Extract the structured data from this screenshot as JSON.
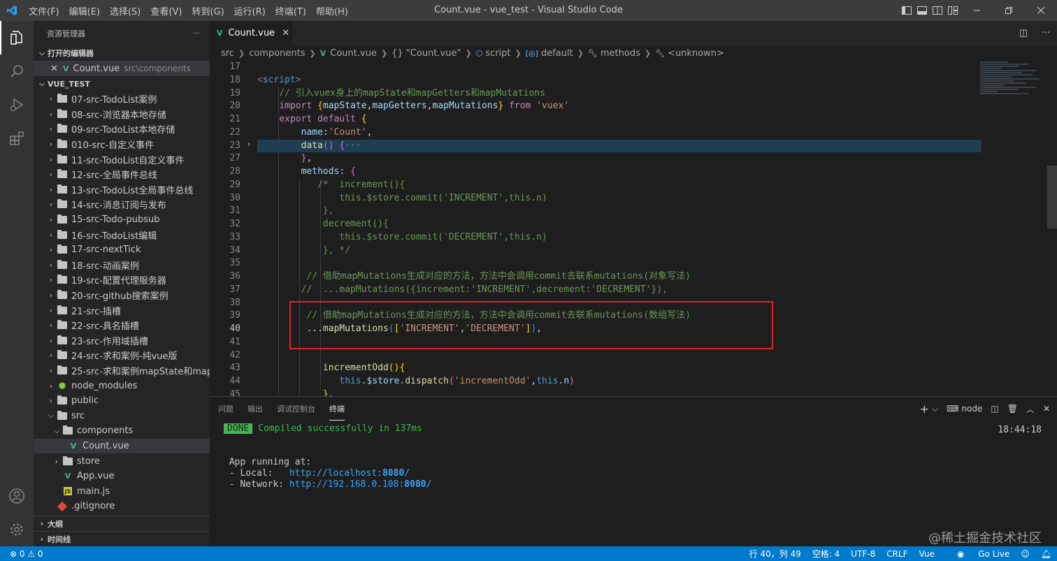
{
  "window": {
    "title": "Count.vue - vue_test - Visual Studio Code",
    "menu": [
      "文件(F)",
      "编辑(E)",
      "选择(S)",
      "查看(V)",
      "转到(G)",
      "运行(R)",
      "终端(T)",
      "帮助(H)"
    ]
  },
  "sidebar": {
    "header": "资源管理器",
    "more": "···",
    "open_editors_label": "打开的编辑器",
    "open_file": {
      "name": "Count.vue",
      "path": "src\\components"
    },
    "project_label": "VUE_TEST",
    "tree": [
      {
        "label": "07-src-TodoList案例",
        "type": "folder"
      },
      {
        "label": "08-src-浏览器本地存储",
        "type": "folder"
      },
      {
        "label": "09-src-TodoList本地存储",
        "type": "folder"
      },
      {
        "label": "010-src-自定义事件",
        "type": "folder"
      },
      {
        "label": "11-src-TodoList自定义事件",
        "type": "folder"
      },
      {
        "label": "12-src-全局事件总线",
        "type": "folder"
      },
      {
        "label": "13-src-TodoList全局事件总线",
        "type": "folder"
      },
      {
        "label": "14-src-消息订阅与发布",
        "type": "folder"
      },
      {
        "label": "15-src-Todo-pubsub",
        "type": "folder"
      },
      {
        "label": "16-src-TodoList编辑",
        "type": "folder"
      },
      {
        "label": "17-src-nextTick",
        "type": "folder"
      },
      {
        "label": "18-src-动画案例",
        "type": "folder"
      },
      {
        "label": "19-src-配置代理服务器",
        "type": "folder"
      },
      {
        "label": "20-src-github搜索案例",
        "type": "folder"
      },
      {
        "label": "21-src-插槽",
        "type": "folder"
      },
      {
        "label": "22-src-具名插槽",
        "type": "folder"
      },
      {
        "label": "23-src-作用域插槽",
        "type": "folder"
      },
      {
        "label": "24-src-求和案例-纯vue版",
        "type": "folder"
      },
      {
        "label": "25-src-求和案例mapState和map...",
        "type": "folder"
      },
      {
        "label": "node_modules",
        "type": "node"
      },
      {
        "label": "public",
        "type": "folder"
      },
      {
        "label": "src",
        "type": "folder-open"
      },
      {
        "label": "components",
        "type": "folder-open",
        "depth": 1
      },
      {
        "label": "Count.vue",
        "type": "vue",
        "depth": 2
      },
      {
        "label": "store",
        "type": "folder",
        "depth": 1
      },
      {
        "label": "App.vue",
        "type": "vue",
        "depth": 1
      },
      {
        "label": "main.js",
        "type": "js",
        "depth": 1
      },
      {
        "label": ".gitignore",
        "type": "git",
        "depth": 0
      }
    ],
    "outline_label": "大纲",
    "timeline_label": "时间线"
  },
  "tab": {
    "label": "Count.vue",
    "close": "✕"
  },
  "breadcrumb": [
    "src",
    "components",
    "Count.vue",
    "{} \"Count.vue\"",
    "script",
    "default",
    "methods",
    "<unknown>"
  ],
  "editor": {
    "line_numbers": [
      "17",
      "18",
      "19",
      "20",
      "21",
      "22",
      "23",
      "27",
      "28",
      "29",
      "30",
      "31",
      "32",
      "33",
      "34",
      "35",
      "36",
      "37",
      "38",
      "39",
      "40",
      "41",
      "42",
      "43",
      "44",
      "45"
    ],
    "current_line": "40"
  },
  "panel": {
    "tabs": [
      "问题",
      "输出",
      "调试控制台",
      "终端"
    ],
    "active_tab": "终端",
    "terminal_name": "node",
    "done_badge": "DONE",
    "compiled": "Compiled successfully in 137ms",
    "time": "18:44:18",
    "app_running": "App running at:",
    "local_label": "- Local:   ",
    "local_url": "http://localhost:",
    "local_port": "8080",
    "network_label": "- Network: ",
    "network_url": "http://192.168.0.108:",
    "network_port": "8080"
  },
  "status": {
    "errors": "⊗ 0 ⚠ 0",
    "position": "行 40，列 49",
    "spaces": "空格: 4",
    "encoding": "UTF-8",
    "eol": "CRLF",
    "language": "Vue",
    "golive": "Go Live"
  },
  "watermark": "@稀土掘金技术社区",
  "colors": {
    "accent": "#007acc",
    "redbox": "#e0242c",
    "vue_green": "#41b883"
  }
}
